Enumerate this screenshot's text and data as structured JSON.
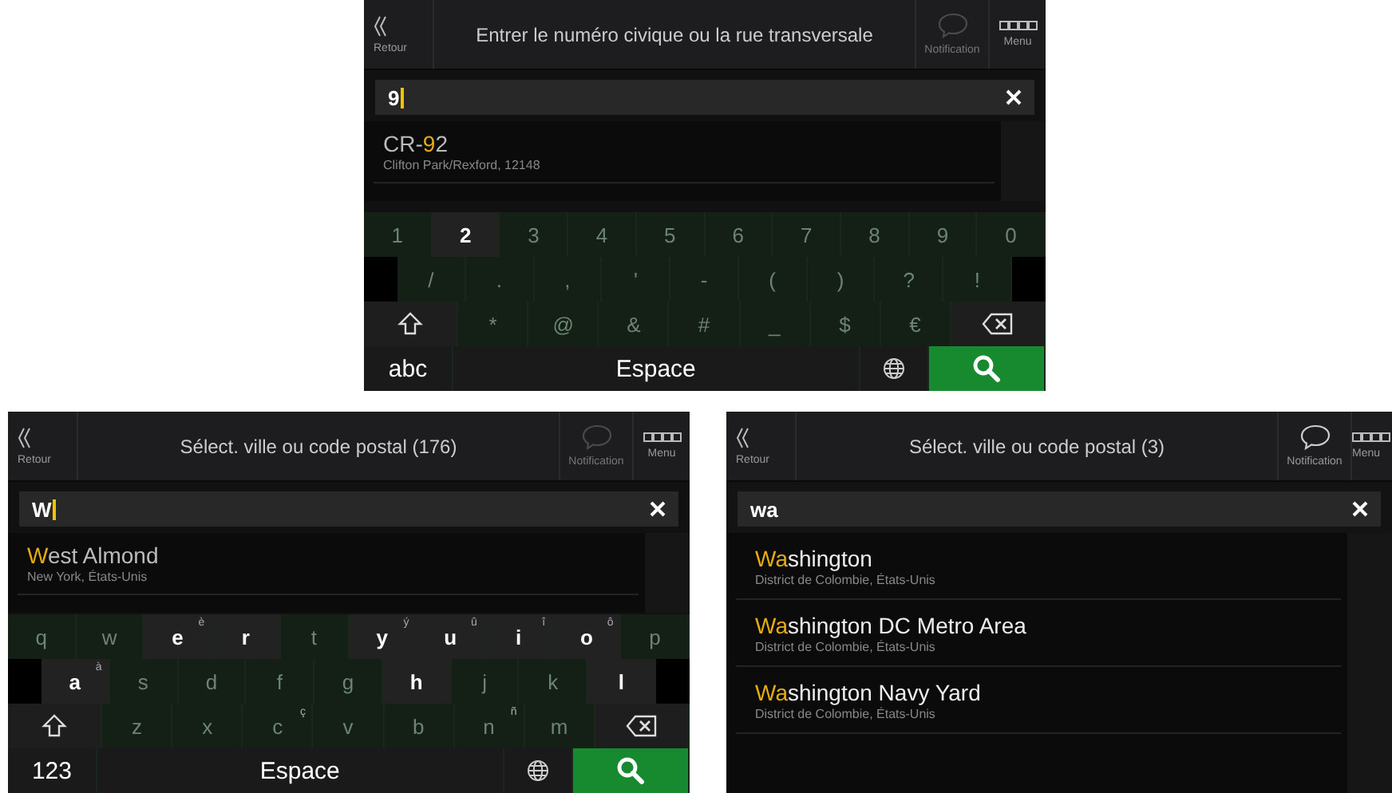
{
  "screens": [
    {
      "header": {
        "back_label": "Retour",
        "title": "Entrer le numéro civique ou la rue transversale",
        "notification": {
          "label": "Notification",
          "enabled": false
        },
        "menu_label": "Menu"
      },
      "field": {
        "value": "9",
        "cursor": true
      },
      "results": [
        {
          "before": "CR-",
          "match": "9",
          "after": "2",
          "subtitle": "Clifton Park/Rexford, 12148"
        }
      ],
      "keyboard": [
        {
          "indented": false,
          "keys": [
            {
              "label": "1",
              "enabled": false
            },
            {
              "label": "2",
              "enabled": true
            },
            {
              "label": "3",
              "enabled": false
            },
            {
              "label": "4",
              "enabled": false
            },
            {
              "label": "5",
              "enabled": false
            },
            {
              "label": "6",
              "enabled": false
            },
            {
              "label": "7",
              "enabled": false
            },
            {
              "label": "8",
              "enabled": false
            },
            {
              "label": "9",
              "enabled": false
            },
            {
              "label": "0",
              "enabled": false
            }
          ]
        },
        {
          "indented": true,
          "keys": [
            {
              "label": "/",
              "enabled": false
            },
            {
              "label": ".",
              "enabled": false
            },
            {
              "label": ",",
              "enabled": false
            },
            {
              "label": "'",
              "enabled": false
            },
            {
              "label": "-",
              "enabled": false
            },
            {
              "label": "(",
              "enabled": false
            },
            {
              "label": ")",
              "enabled": false
            },
            {
              "label": "?",
              "enabled": false
            },
            {
              "label": "!",
              "enabled": false
            }
          ]
        },
        {
          "indented": false,
          "keys": [
            {
              "kind": "shift",
              "enabled": true
            },
            {
              "label": "*",
              "enabled": false
            },
            {
              "label": "@",
              "enabled": false
            },
            {
              "label": "&",
              "enabled": false
            },
            {
              "label": "#",
              "enabled": false
            },
            {
              "label": "_",
              "enabled": false
            },
            {
              "label": "$",
              "enabled": false
            },
            {
              "label": "€",
              "enabled": false
            },
            {
              "kind": "backspace",
              "enabled": true
            }
          ]
        },
        {
          "indented": false,
          "keys": [
            {
              "kind": "mode",
              "label": "abc",
              "enabled": true
            },
            {
              "kind": "space",
              "label": "Espace",
              "enabled": true
            },
            {
              "kind": "globe",
              "enabled": true
            },
            {
              "kind": "search",
              "enabled": true
            }
          ]
        }
      ]
    },
    {
      "header": {
        "back_label": "Retour",
        "title": "Sélect. ville ou code postal (176)",
        "notification": {
          "label": "Notification",
          "enabled": false
        },
        "menu_label": "Menu"
      },
      "field": {
        "value": "W",
        "cursor": true
      },
      "results": [
        {
          "match": "W",
          "after": "est Almond",
          "subtitle": "New York, États-Unis"
        }
      ],
      "keyboard": [
        {
          "indented": false,
          "keys": [
            {
              "label": "q",
              "enabled": false
            },
            {
              "label": "w",
              "enabled": false
            },
            {
              "label": "e",
              "hint": "è",
              "enabled": true
            },
            {
              "label": "r",
              "enabled": true
            },
            {
              "label": "t",
              "enabled": false
            },
            {
              "label": "y",
              "hint": "ý",
              "enabled": true
            },
            {
              "label": "u",
              "hint": "û",
              "enabled": true
            },
            {
              "label": "i",
              "hint": "î",
              "enabled": true
            },
            {
              "label": "o",
              "hint": "ô",
              "enabled": true
            },
            {
              "label": "p",
              "enabled": false
            }
          ]
        },
        {
          "indented": true,
          "keys": [
            {
              "label": "a",
              "hint": "à",
              "enabled": true
            },
            {
              "label": "s",
              "enabled": false
            },
            {
              "label": "d",
              "enabled": false
            },
            {
              "label": "f",
              "enabled": false
            },
            {
              "label": "g",
              "enabled": false
            },
            {
              "label": "h",
              "enabled": true
            },
            {
              "label": "j",
              "enabled": false
            },
            {
              "label": "k",
              "enabled": false
            },
            {
              "label": "l",
              "enabled": true
            }
          ]
        },
        {
          "indented": false,
          "keys": [
            {
              "kind": "shift",
              "enabled": true
            },
            {
              "label": "z",
              "enabled": false
            },
            {
              "label": "x",
              "enabled": false
            },
            {
              "label": "c",
              "hint": "ç",
              "enabled": false
            },
            {
              "label": "v",
              "enabled": false
            },
            {
              "label": "b",
              "enabled": false
            },
            {
              "label": "n",
              "hint": "ñ",
              "enabled": false
            },
            {
              "label": "m",
              "enabled": false
            },
            {
              "kind": "backspace",
              "enabled": true
            }
          ]
        },
        {
          "indented": false,
          "keys": [
            {
              "kind": "mode",
              "label": "123",
              "enabled": true
            },
            {
              "kind": "space",
              "label": "Espace",
              "enabled": true
            },
            {
              "kind": "globe",
              "enabled": true
            },
            {
              "kind": "search",
              "enabled": true
            }
          ]
        }
      ]
    },
    {
      "header": {
        "back_label": "Retour",
        "title": "Sélect. ville ou code postal (3)",
        "notification": {
          "label": "Notification",
          "enabled": true
        },
        "menu_label": "Menu"
      },
      "field": {
        "value": "wa",
        "cursor": false
      },
      "results": [
        {
          "match": "Wa",
          "after": "shington",
          "subtitle": "District de Colombie, États-Unis"
        },
        {
          "match": "Wa",
          "after": "shington DC Metro Area",
          "subtitle": "District de Colombie, États-Unis"
        },
        {
          "match": "Wa",
          "after": "shington Navy Yard",
          "subtitle": "District de Colombie, États-Unis"
        }
      ]
    }
  ]
}
